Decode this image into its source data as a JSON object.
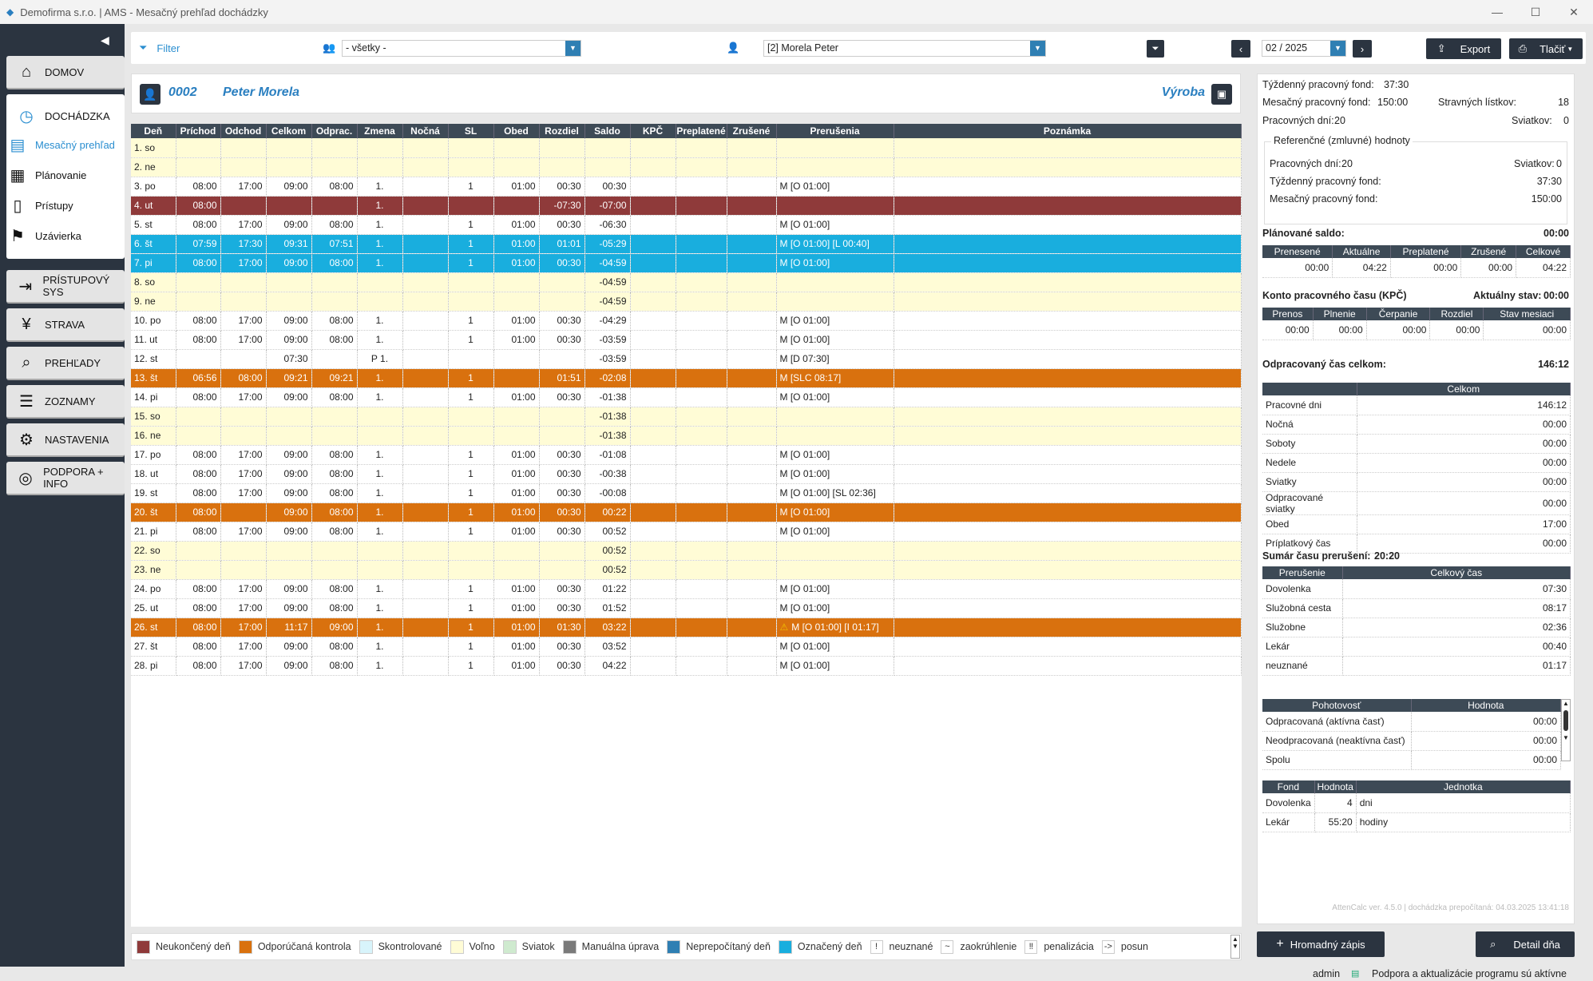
{
  "window": {
    "title": "Demofirma s.r.o. | AMS - Mesačný prehľad dochádzky"
  },
  "sidebar": {
    "main_buttons": [
      {
        "label": "DOMOV",
        "icon": "home-icon"
      },
      {
        "label": "DOCHÁDZKA",
        "icon": "clock-icon"
      },
      {
        "label": "PRÍSTUPOVÝ SYS",
        "icon": "login-icon"
      },
      {
        "label": "STRAVA",
        "icon": "cutlery-icon"
      },
      {
        "label": "PREHĽADY",
        "icon": "magnifier-icon"
      },
      {
        "label": "ZOZNAMY",
        "icon": "list-icon"
      },
      {
        "label": "NASTAVENIA",
        "icon": "gear-icon"
      },
      {
        "label": "PODPORA + INFO",
        "icon": "lifebuoy-icon"
      }
    ],
    "sub_items": [
      {
        "label": "Mesačný prehľad",
        "active": true,
        "icon": "book-icon"
      },
      {
        "label": "Plánovanie",
        "icon": "calendar-icon"
      },
      {
        "label": "Prístupy",
        "icon": "door-icon"
      },
      {
        "label": "Uzávierka",
        "icon": "flag-icon"
      }
    ]
  },
  "toolbar": {
    "filter_label": "Filter",
    "group_value": "- všetky -",
    "person_value": "[2] Morela Peter",
    "period_value": "02 / 2025",
    "export_label": "Export",
    "print_label": "Tlačiť"
  },
  "employee": {
    "number": "0002",
    "name": "Peter  Morela",
    "department": "Výroba"
  },
  "table": {
    "columns": [
      "Deň",
      "Príchod",
      "Odchod",
      "Celkom",
      "Odprac.",
      "Zmena",
      "Nočná",
      "SL",
      "Obed",
      "Rozdiel",
      "Saldo",
      "KPČ",
      "Preplatené",
      "Zrušené",
      "Prerušenia",
      "Poznámka"
    ],
    "rows": [
      {
        "style": "free",
        "c": [
          "1. so",
          "",
          "",
          "",
          "",
          "",
          "",
          "",
          "",
          "",
          "",
          "",
          "",
          "",
          "",
          ""
        ]
      },
      {
        "style": "free",
        "c": [
          "2. ne",
          "",
          "",
          "",
          "",
          "",
          "",
          "",
          "",
          "",
          "",
          "",
          "",
          "",
          "",
          ""
        ]
      },
      {
        "style": "",
        "c": [
          "3. po",
          "08:00",
          "17:00",
          "09:00",
          "08:00",
          "1.",
          "",
          "1",
          "01:00",
          "00:30",
          "00:30",
          "",
          "",
          "",
          "M [O 01:00]",
          ""
        ]
      },
      {
        "style": "red",
        "c": [
          "4. ut",
          "08:00",
          "",
          "",
          "",
          "1.",
          "",
          "",
          "",
          "-07:30",
          "-07:00",
          "",
          "",
          "",
          "",
          ""
        ]
      },
      {
        "style": "",
        "c": [
          "5. st",
          "08:00",
          "17:00",
          "09:00",
          "08:00",
          "1.",
          "",
          "1",
          "01:00",
          "00:30",
          "-06:30",
          "",
          "",
          "",
          "M [O 01:00]",
          ""
        ]
      },
      {
        "style": "blue",
        "c": [
          "6. št",
          "07:59",
          "17:30",
          "09:31",
          "07:51",
          "1.",
          "",
          "1",
          "01:00",
          "01:01",
          "-05:29",
          "",
          "",
          "",
          "M [O 01:00] [L 00:40]",
          ""
        ]
      },
      {
        "style": "blue",
        "c": [
          "7. pi",
          "08:00",
          "17:00",
          "09:00",
          "08:00",
          "1.",
          "",
          "1",
          "01:00",
          "00:30",
          "-04:59",
          "",
          "",
          "",
          "M [O 01:00]",
          ""
        ]
      },
      {
        "style": "free",
        "c": [
          "8. so",
          "",
          "",
          "",
          "",
          "",
          "",
          "",
          "",
          "",
          "-04:59",
          "",
          "",
          "",
          "",
          ""
        ]
      },
      {
        "style": "free",
        "c": [
          "9. ne",
          "",
          "",
          "",
          "",
          "",
          "",
          "",
          "",
          "",
          "-04:59",
          "",
          "",
          "",
          "",
          ""
        ]
      },
      {
        "style": "",
        "c": [
          "10. po",
          "08:00",
          "17:00",
          "09:00",
          "08:00",
          "1.",
          "",
          "1",
          "01:00",
          "00:30",
          "-04:29",
          "",
          "",
          "",
          "M [O 01:00]",
          ""
        ]
      },
      {
        "style": "",
        "c": [
          "11. ut",
          "08:00",
          "17:00",
          "09:00",
          "08:00",
          "1.",
          "",
          "1",
          "01:00",
          "00:30",
          "-03:59",
          "",
          "",
          "",
          "M [O 01:00]",
          ""
        ]
      },
      {
        "style": "",
        "c": [
          "12. st",
          "",
          "",
          "07:30",
          "",
          "P 1.",
          "",
          "",
          "",
          "",
          "-03:59",
          "",
          "",
          "",
          "M [D 07:30]",
          ""
        ]
      },
      {
        "style": "orange",
        "c": [
          "13. št",
          "06:56",
          "08:00",
          "09:21",
          "09:21",
          "1.",
          "",
          "1",
          "",
          "01:51",
          "-02:08",
          "",
          "",
          "",
          "M [SLC 08:17]",
          ""
        ]
      },
      {
        "style": "",
        "c": [
          "14. pi",
          "08:00",
          "17:00",
          "09:00",
          "08:00",
          "1.",
          "",
          "1",
          "01:00",
          "00:30",
          "-01:38",
          "",
          "",
          "",
          "M [O 01:00]",
          ""
        ]
      },
      {
        "style": "free",
        "c": [
          "15. so",
          "",
          "",
          "",
          "",
          "",
          "",
          "",
          "",
          "",
          "-01:38",
          "",
          "",
          "",
          "",
          ""
        ]
      },
      {
        "style": "free",
        "c": [
          "16. ne",
          "",
          "",
          "",
          "",
          "",
          "",
          "",
          "",
          "",
          "-01:38",
          "",
          "",
          "",
          "",
          ""
        ]
      },
      {
        "style": "",
        "c": [
          "17. po",
          "08:00",
          "17:00",
          "09:00",
          "08:00",
          "1.",
          "",
          "1",
          "01:00",
          "00:30",
          "-01:08",
          "",
          "",
          "",
          "M [O 01:00]",
          ""
        ]
      },
      {
        "style": "",
        "c": [
          "18. ut",
          "08:00",
          "17:00",
          "09:00",
          "08:00",
          "1.",
          "",
          "1",
          "01:00",
          "00:30",
          "-00:38",
          "",
          "",
          "",
          "M [O 01:00]",
          ""
        ]
      },
      {
        "style": "",
        "c": [
          "19. st",
          "08:00",
          "17:00",
          "09:00",
          "08:00",
          "1.",
          "",
          "1",
          "01:00",
          "00:30",
          "-00:08",
          "",
          "",
          "",
          "M [O 01:00] [SL 02:36]",
          ""
        ]
      },
      {
        "style": "orange",
        "c": [
          "20. št",
          "08:00",
          "",
          "09:00",
          "08:00",
          "1.",
          "",
          "1",
          "01:00",
          "00:30",
          "00:22",
          "",
          "",
          "",
          "M [O 01:00]",
          ""
        ]
      },
      {
        "style": "",
        "c": [
          "21. pi",
          "08:00",
          "17:00",
          "09:00",
          "08:00",
          "1.",
          "",
          "1",
          "01:00",
          "00:30",
          "00:52",
          "",
          "",
          "",
          "M [O 01:00]",
          ""
        ]
      },
      {
        "style": "free",
        "c": [
          "22. so",
          "",
          "",
          "",
          "",
          "",
          "",
          "",
          "",
          "",
          "00:52",
          "",
          "",
          "",
          "",
          ""
        ]
      },
      {
        "style": "free",
        "c": [
          "23. ne",
          "",
          "",
          "",
          "",
          "",
          "",
          "",
          "",
          "",
          "00:52",
          "",
          "",
          "",
          "",
          ""
        ]
      },
      {
        "style": "",
        "c": [
          "24. po",
          "08:00",
          "17:00",
          "09:00",
          "08:00",
          "1.",
          "",
          "1",
          "01:00",
          "00:30",
          "01:22",
          "",
          "",
          "",
          "M [O 01:00]",
          ""
        ]
      },
      {
        "style": "",
        "c": [
          "25. ut",
          "08:00",
          "17:00",
          "09:00",
          "08:00",
          "1.",
          "",
          "1",
          "01:00",
          "00:30",
          "01:52",
          "",
          "",
          "",
          "M [O 01:00]",
          ""
        ]
      },
      {
        "style": "orange",
        "warn": true,
        "c": [
          "26. st",
          "08:00",
          "17:00",
          "11:17",
          "09:00",
          "1.",
          "",
          "1",
          "01:00",
          "01:30",
          "03:22",
          "",
          "",
          "",
          "M [O 01:00] [I 01:17]",
          ""
        ]
      },
      {
        "style": "",
        "c": [
          "27. št",
          "08:00",
          "17:00",
          "09:00",
          "08:00",
          "1.",
          "",
          "1",
          "01:00",
          "00:30",
          "03:52",
          "",
          "",
          "",
          "M [O 01:00]",
          ""
        ]
      },
      {
        "style": "",
        "c": [
          "28. pi",
          "08:00",
          "17:00",
          "09:00",
          "08:00",
          "1.",
          "",
          "1",
          "01:00",
          "00:30",
          "04:22",
          "",
          "",
          "",
          "M [O 01:00]",
          ""
        ]
      }
    ]
  },
  "legend": [
    {
      "label": "Neukončený deň",
      "color": "#8f3a3a"
    },
    {
      "label": "Odporúčaná kontrola",
      "color": "#d9710e"
    },
    {
      "label": "Skontrolované",
      "color": "#d8f4fb"
    },
    {
      "label": "Voľno",
      "color": "#fffcd6"
    },
    {
      "label": "Sviatok",
      "color": "#cfeacf"
    },
    {
      "label": "Manuálna úprava",
      "color": "#7a7a7a"
    },
    {
      "label": "Neprepočítaný deň",
      "color": "#2f7fb3"
    },
    {
      "label": "Označený deň",
      "color": "#19aede"
    },
    {
      "label": "neuznané",
      "symbol": "!"
    },
    {
      "label": "zaokrúhlenie",
      "symbol": "~"
    },
    {
      "label": "penalizácia",
      "symbol": "‼"
    },
    {
      "label": "posun",
      "symbol": "->"
    }
  ],
  "summary": {
    "weekly_fund_label": "Týždenný pracovný fond:",
    "weekly_fund": "37:30",
    "monthly_fund_label": "Mesačný pracovný fond:",
    "monthly_fund": "150:00",
    "meal_label": "Stravných lístkov:",
    "meal": "18",
    "work_days_label": "Pracovných dní:",
    "work_days": "20",
    "holidays_label": "Sviatkov:",
    "holidays": "0",
    "ref_title": "Referenčné (zmluvné) hodnoty",
    "ref_work_days_label": "Pracovných dní:",
    "ref_work_days": "20",
    "ref_holidays_label": "Sviatkov:",
    "ref_holidays": "0",
    "ref_weekly_label": "Týždenný pracovný fond:",
    "ref_weekly": "37:30",
    "ref_monthly_label": "Mesačný pracovný fond:",
    "ref_monthly": "150:00",
    "planned_label": "Plánované saldo:",
    "planned": "00:00",
    "saldo_cols": [
      "Prenesené",
      "Aktuálne",
      "Preplatené",
      "Zrušené",
      "Celkové"
    ],
    "saldo_vals": [
      "00:00",
      "04:22",
      "00:00",
      "00:00",
      "04:22"
    ],
    "kpc_label": "Konto pracovného času (KPČ)",
    "kpc_state_label": "Aktuálny stav:",
    "kpc_state": "00:00",
    "kpc_cols": [
      "Prenos",
      "Plnenie",
      "Čerpanie",
      "Rozdiel",
      "Stav mesiaci"
    ],
    "kpc_vals": [
      "00:00",
      "00:00",
      "00:00",
      "00:00",
      "00:00"
    ],
    "worked_total_label": "Odpracovaný čas celkom:",
    "worked_total": "146:12",
    "total_col": "Celkom",
    "totals": [
      {
        "k": "Pracovné dni",
        "v": "146:12"
      },
      {
        "k": "Nočná",
        "v": "00:00"
      },
      {
        "k": "Soboty",
        "v": "00:00"
      },
      {
        "k": "Nedele",
        "v": "00:00"
      },
      {
        "k": "Sviatky",
        "v": "00:00"
      },
      {
        "k": "Odpracované sviatky",
        "v": "00:00"
      },
      {
        "k": "Obed",
        "v": "17:00"
      },
      {
        "k": "Príplatkový čas",
        "v": "00:00"
      }
    ],
    "interrupt_sum_label": "Sumár času prerušení:",
    "interrupt_sum": "20:20",
    "interrupt_cols": [
      "Prerušenie",
      "Celkový čas"
    ],
    "interrupts": [
      {
        "k": "Dovolenka",
        "v": "07:30"
      },
      {
        "k": "Služobná cesta",
        "v": "08:17"
      },
      {
        "k": "Služobne",
        "v": "02:36"
      },
      {
        "k": "Lekár",
        "v": "00:40"
      },
      {
        "k": "neuznané",
        "v": "01:17"
      }
    ],
    "standby_cols": [
      "Pohotovosť",
      "Hodnota"
    ],
    "standby": [
      {
        "k": "Odpracovaná (aktívna časť)",
        "v": "00:00"
      },
      {
        "k": "Neodpracovaná (neaktívna časť)",
        "v": "00:00"
      },
      {
        "k": "Spolu",
        "v": "00:00"
      }
    ],
    "fund_cols": [
      "Fond",
      "Hodnota",
      "Jednotka"
    ],
    "funds": [
      {
        "k": "Dovolenka",
        "v": "4",
        "u": "dni"
      },
      {
        "k": "Lekár",
        "v": "55:20",
        "u": "hodiny"
      }
    ],
    "version": "AttenCalc ver. 4.5.0 | dochádzka prepočítaná: 04.03.2025 13:41:18"
  },
  "actions": {
    "bulk_label": "Hromadný zápis",
    "detail_label": "Detail dňa"
  },
  "status": {
    "user": "admin",
    "message": "Podpora a aktualizácie programu sú aktívne"
  }
}
